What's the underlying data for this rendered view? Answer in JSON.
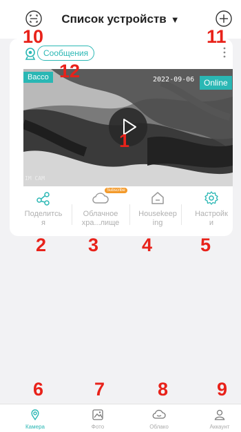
{
  "header": {
    "title": "Список устройств",
    "caret": "▼",
    "left_icon": "scan-icon",
    "right_icon": "add-icon"
  },
  "device": {
    "messages_label": "Сообщения",
    "name": "Вассо",
    "status": "Online",
    "timestamp": "2022-09-06",
    "watermark": "IM CAM"
  },
  "actions": [
    {
      "label": "Поделитсь\nя",
      "icon": "share-icon"
    },
    {
      "label": "Облачное\nхра...лище",
      "icon": "cloud-icon",
      "badge": "Subscribe"
    },
    {
      "label": "Housekeep\ning",
      "icon": "home-icon"
    },
    {
      "label": "Настройк\nи",
      "icon": "gear-icon"
    }
  ],
  "tabs": [
    {
      "label": "Камера",
      "icon": "camera-tab-icon",
      "active": true
    },
    {
      "label": "Фото",
      "icon": "photo-icon",
      "active": false
    },
    {
      "label": "Облако",
      "icon": "cloud-tab-icon",
      "active": false
    },
    {
      "label": "Аккаунт",
      "icon": "account-icon",
      "active": false
    }
  ],
  "markers": [
    "1",
    "2",
    "3",
    "4",
    "5",
    "6",
    "7",
    "8",
    "9",
    "10",
    "11",
    "12"
  ],
  "colors": {
    "accent": "#2ab7b4",
    "marker": "#e8221a",
    "badge": "#f39a2b",
    "background": "#f2f2f4"
  }
}
